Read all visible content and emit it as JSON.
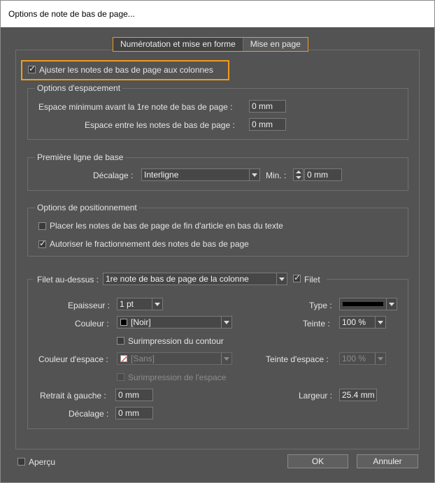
{
  "window": {
    "title": "Options de note de bas de page..."
  },
  "tabs": [
    {
      "label": "Numérotation et mise en forme"
    },
    {
      "label": "Mise en page"
    }
  ],
  "adjust_columns": {
    "label": "Ajuster les notes de bas de page aux colonnes",
    "checked": true
  },
  "spacing": {
    "title": "Options d'espacement",
    "min_before_label": "Espace minimum avant la 1re note de bas de page :",
    "min_before_value": "0 mm",
    "between_label": "Espace entre les notes de bas de page :",
    "between_value": "0 mm"
  },
  "baseline": {
    "title": "Première ligne de base",
    "offset_label": "Décalage :",
    "offset_value": "Interligne",
    "min_label": "Min. :",
    "min_value": "0 mm"
  },
  "positioning": {
    "title": "Options de positionnement",
    "place_end_label": "Placer les notes de bas de page de fin d'article en bas du texte",
    "place_end_checked": false,
    "allow_split_label": "Autoriser le fractionnement des notes de bas de page",
    "allow_split_checked": true
  },
  "rule": {
    "above_label": "Filet au-dessus :",
    "above_value": "1re note de bas de page de la colonne",
    "rule_on_label": "Filet",
    "rule_on_checked": true,
    "weight_label": "Epaisseur :",
    "weight_value": "1 pt",
    "type_label": "Type :",
    "color_label": "Couleur :",
    "color_value": "[Noir]",
    "tint_label": "Teinte :",
    "tint_value": "100 %",
    "overprint_stroke_label": "Surimpression du contour",
    "overprint_stroke_checked": false,
    "gap_color_label": "Couleur d'espace :",
    "gap_color_value": "[Sans]",
    "gap_tint_label": "Teinte d'espace :",
    "gap_tint_value": "100 %",
    "overprint_gap_label": "Surimpression de l'espace",
    "left_indent_label": "Retrait à gauche :",
    "left_indent_value": "0 mm",
    "width_label": "Largeur :",
    "width_value": "25.4 mm",
    "offset_label": "Décalage :",
    "offset_value": "0 mm"
  },
  "footer": {
    "preview_label": "Aperçu",
    "preview_checked": false,
    "ok_label": "OK",
    "cancel_label": "Annuler"
  }
}
